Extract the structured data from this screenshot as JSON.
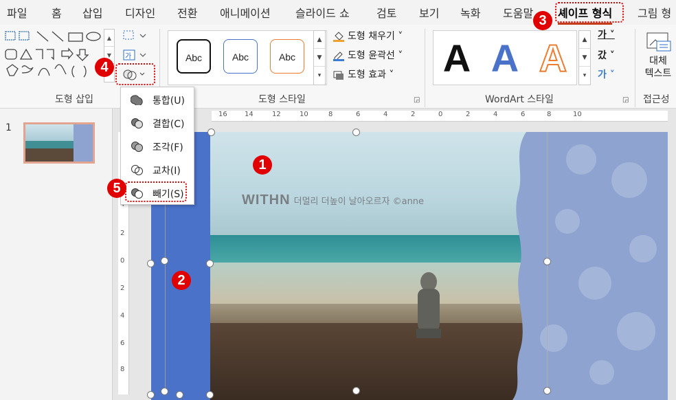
{
  "tabs": [
    "파일",
    "홈",
    "삽입",
    "디자인",
    "전환",
    "애니메이션",
    "슬라이드 쇼",
    "검토",
    "보기",
    "녹화",
    "도움말",
    "셰이프 형식",
    "그림 형"
  ],
  "active_tab": "셰이프 형식",
  "ribbon": {
    "groups": {
      "insert_shapes": "도형 삽입",
      "shape_styles": "도형 스타일",
      "wordart_styles": "WordArt 스타일",
      "accessibility": "접근성"
    },
    "style_preview_text": "Abc",
    "commands": {
      "fill": "도형 채우기",
      "outline": "도형 윤곽선",
      "effects": "도형 효과"
    },
    "wordart_letter": "A",
    "text_buttons": [
      "가",
      "갔",
      "가"
    ],
    "alt_text": "대체\n텍스트",
    "small_btn_glyph": "가",
    "text_box_glyph": "가"
  },
  "merge_menu": {
    "items": [
      "통합(U)",
      "결합(C)",
      "조각(F)",
      "교차(I)",
      "빼기(S)"
    ]
  },
  "slides": {
    "current": "1"
  },
  "slide": {
    "watermark_brand": "WITHN",
    "watermark_text": "더멀리 더높이 날아오르자 ©anne"
  },
  "rulers": {
    "horizontal": [
      "16",
      "14",
      "12",
      "10",
      "8",
      "6",
      "4",
      "2",
      "0",
      "2",
      "4",
      "6",
      "8",
      "10"
    ],
    "vertical": [
      "4",
      "2",
      "0",
      "2",
      "4",
      "6",
      "8"
    ]
  },
  "badges": [
    "1",
    "2",
    "3",
    "4",
    "5"
  ],
  "colors": {
    "accent": "#c43e1c",
    "annotation_red": "#e00000",
    "blue_rect": "#4a72c9",
    "menu_highlight": "#e00000"
  }
}
